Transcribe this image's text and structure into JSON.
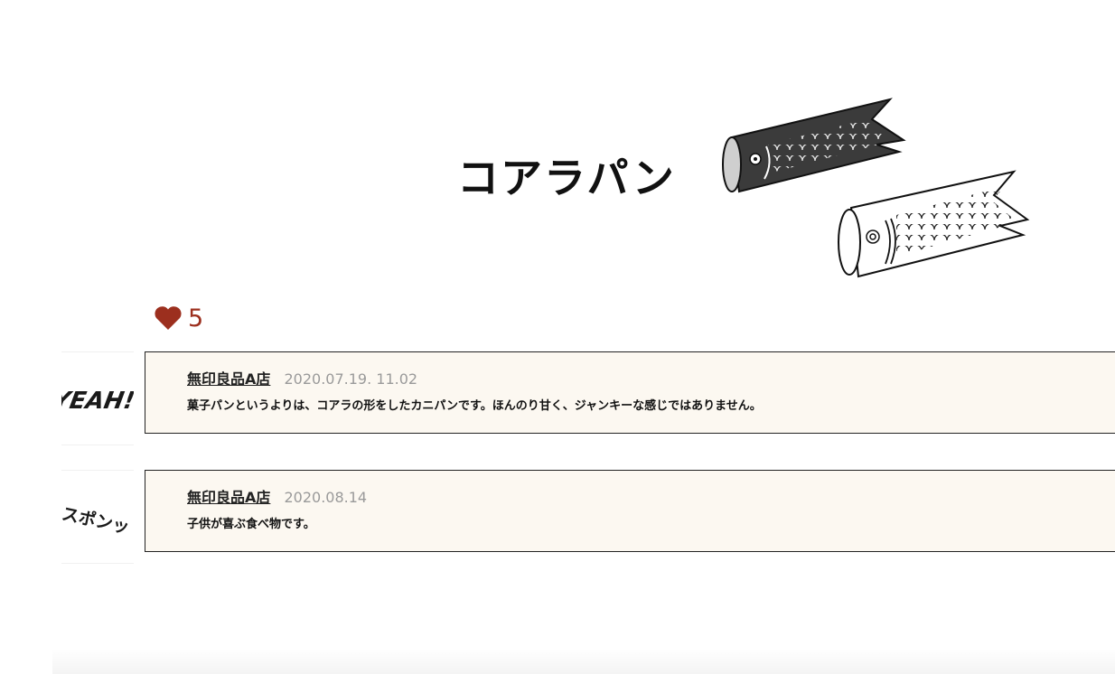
{
  "product": {
    "title": "コアラパン"
  },
  "likes": {
    "icon": "heart-icon",
    "count": "5",
    "color": "#9c2f1e"
  },
  "comments": [
    {
      "stamp": "YEAH!",
      "author": "無印良品A店",
      "date": "2020.07.19. 11.02",
      "text": "菓子パンというよりは、コアラの形をしたカニパンです。ほんのり甘く、ジャンキーな感じではありません。"
    },
    {
      "stamp": "スポンッ",
      "author": "無印良品A店",
      "date": "2020.08.14",
      "text": "子供が喜ぶ食べ物です。"
    }
  ],
  "colors": {
    "comment_bg": "#fcf8f1",
    "date": "#9a9a9a"
  }
}
